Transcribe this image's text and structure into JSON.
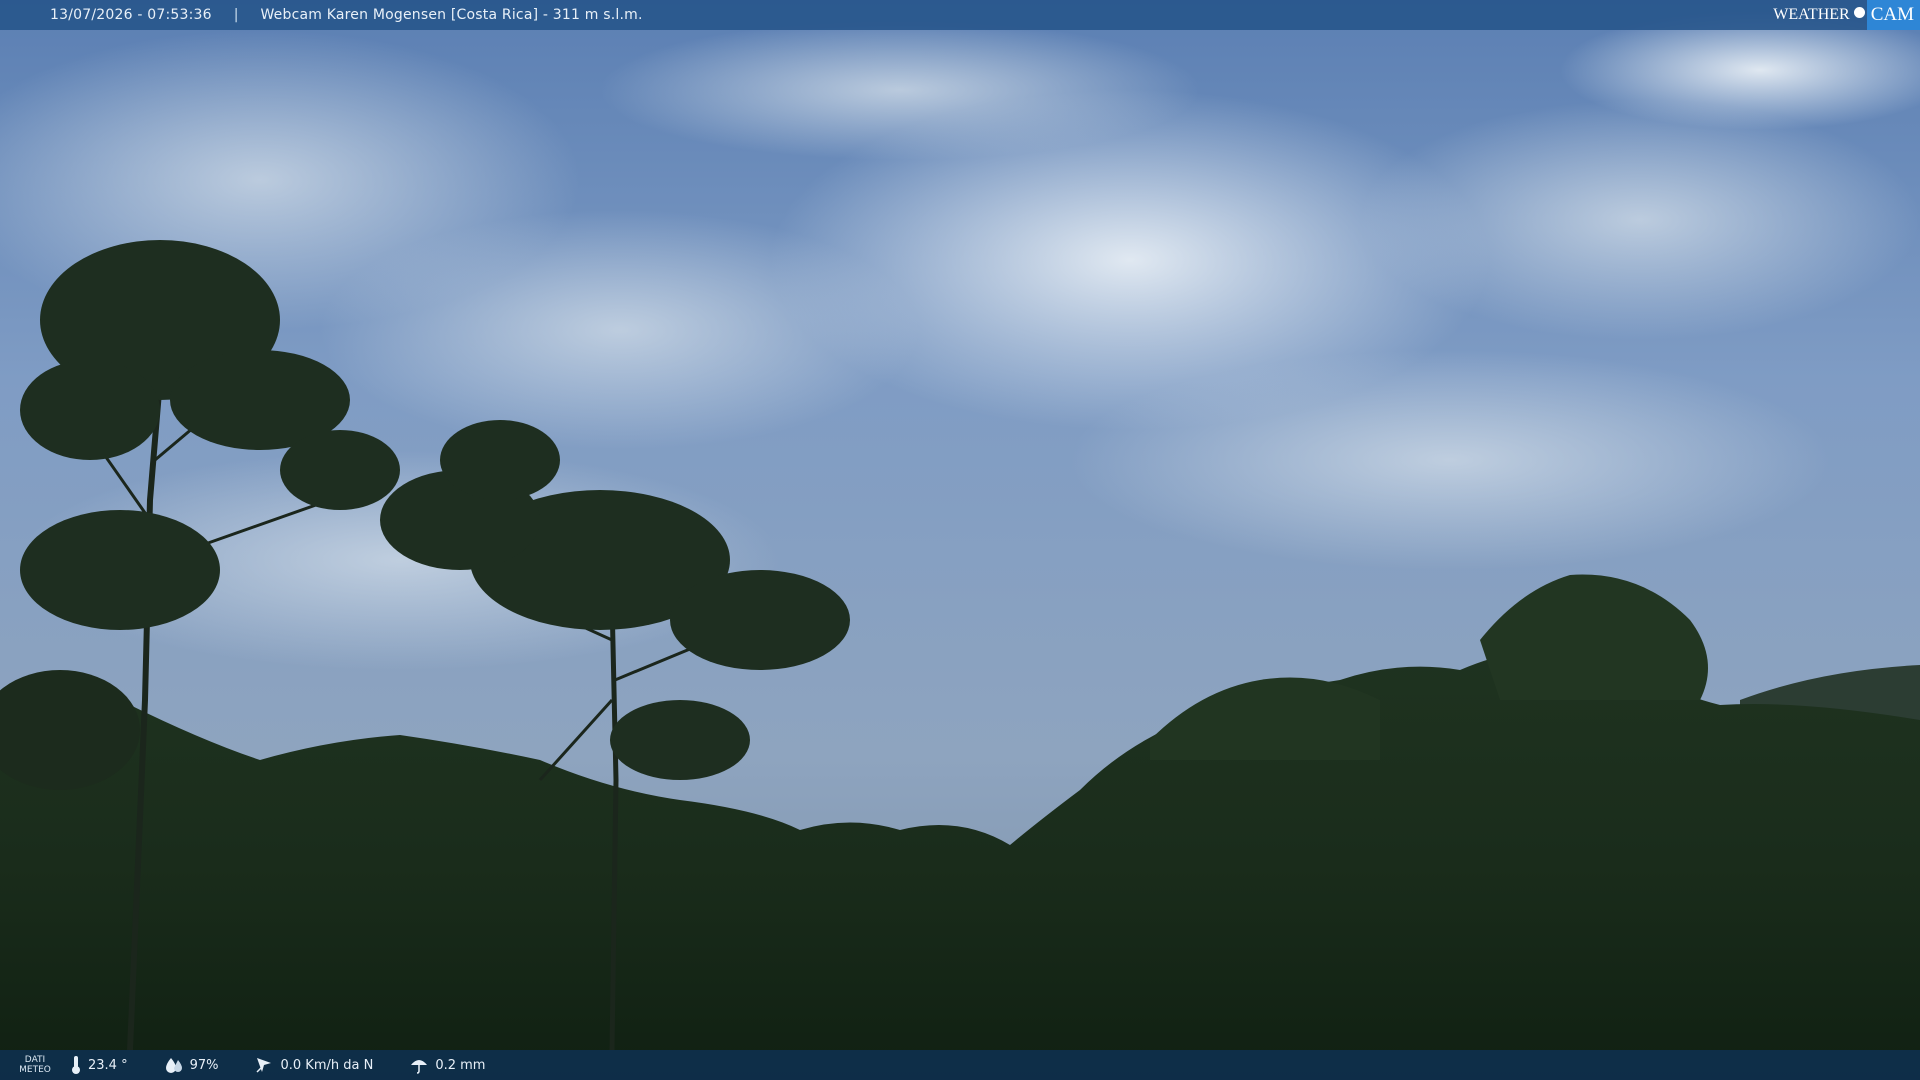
{
  "header": {
    "datetime": "13/07/2026 - 07:53:36",
    "separator": "|",
    "title": "Webcam Karen Mogensen [Costa Rica] - 311 m s.l.m."
  },
  "brand": {
    "weather": "WEATHER",
    "cam": "CAM"
  },
  "weather": {
    "dati_line1": "DATI",
    "dati_line2": "METEO",
    "temperature": "23.4 °",
    "humidity": "97%",
    "wind": "0.0 Km/h da N",
    "rain": "0.2 mm"
  },
  "icons": [
    "thermometer-icon",
    "humidity-drop-icon",
    "wind-icon",
    "rain-umbrella-icon"
  ],
  "colors": {
    "topbar": "#26548a",
    "bottombar": "#0e3052",
    "brand_accent": "#2e86d6"
  }
}
